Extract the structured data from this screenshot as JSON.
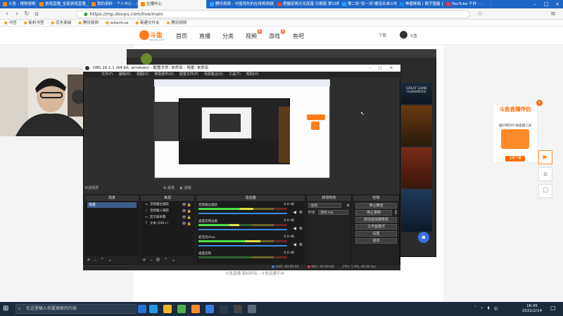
{
  "browser": {
    "tabs": [
      {
        "label": "斗鱼 - 搜狗搜索",
        "active": false
      },
      {
        "label": "游戏直播_全部游戏直播_斗鱼直播",
        "active": false
      },
      {
        "label": "我的资料 - 个人中心 - 斗鱼",
        "active": false
      },
      {
        "label": "主播中心",
        "active": true
      },
      {
        "label": "腾讯视频 - 中国领先的在线视频媒体",
        "active": false
      },
      {
        "label": "把握疫情文化底蕴 日报版 第33期",
        "active": false
      },
      {
        "label": "神盾降临 ( 数字图鉴 ) - 知乎",
        "active": false
      },
      {
        "label": "第二轮\"双一流\"建设名单公布",
        "active": false
      },
      {
        "label": "YouTube 千杯 - ..",
        "active": false
      }
    ],
    "url": "https://mp.douyu.com/live/main",
    "bookmarks": [
      "书签",
      "新机书签",
      "京东商城",
      "腾讯视频",
      "edianhua",
      "新建文件夹",
      "腾讯视频"
    ]
  },
  "douyu": {
    "logo_text": "斗鱼",
    "logo_sub": "douyu.com",
    "nav": [
      {
        "label": "首页",
        "badge": ""
      },
      {
        "label": "直播",
        "badge": ""
      },
      {
        "label": "分类",
        "badge": ""
      },
      {
        "label": "视频",
        "badge": "新"
      },
      {
        "label": "游戏",
        "badge": "热"
      },
      {
        "label": "鱼吧",
        "badge": ""
      }
    ],
    "download": "下载",
    "user": "斗鱼",
    "footer_text": "斗鱼直播 版权所有 · 斗鱼直播平台"
  },
  "obs": {
    "title": "OBS 26.1.1 (64-bit, windows) - 配置文件: 未命名 - 场景: 未命名",
    "menu": [
      "文件(F)",
      "编辑(E)",
      "视图(V)",
      "停靠部件(D)",
      "配置文件(P)",
      "场景集合(S)",
      "工具(T)",
      "帮助(H)"
    ],
    "no_source": "未选择源",
    "preview_controls": [
      "属性",
      "滤镜"
    ],
    "scenes_title": "场景",
    "scenes": [
      "场景"
    ],
    "sources_title": "来源",
    "sources": [
      {
        "icon": "audio-output-icon",
        "label": "音频输出捕获"
      },
      {
        "icon": "mic-icon",
        "label": "音频输入捕获"
      },
      {
        "icon": "window-capture-icon",
        "label": "显示器采集"
      },
      {
        "icon": "text-icon",
        "label": "文本 (GDI+)"
      }
    ],
    "mixer_title": "混音器",
    "mixer": [
      {
        "name": "音频输出捕获",
        "db": "0.0 dB",
        "level": 0.62
      },
      {
        "name": "桌面音频设备",
        "db": "0.0 dB",
        "level": 0.46
      },
      {
        "name": "麦克风/Aux",
        "db": "0.0 dB",
        "level": 0.7
      },
      {
        "name": "桌面音频",
        "db": "0.0 dB",
        "level": 0.0
      }
    ],
    "transitions_title": "转场特效",
    "transition_value": "淡出",
    "duration_label": "时长",
    "duration_value": "300 ms",
    "controls_title": "控制",
    "controls": [
      "停止推流",
      "停止录制",
      "启动虚拟摄像机",
      "工作室模式",
      "设置",
      "退出"
    ],
    "status": [
      "LIVE: 00:00:00",
      "REC: 00:00:00",
      "CPU: 1.4%, 60.00 fps"
    ]
  },
  "side": {
    "guarantee": "GREAT GAME GUARANTEE"
  },
  "ad": {
    "title": "斗鱼直播伴侣",
    "sub": "超好用的PC端直播工具",
    "button": "立即下载",
    "close": "×"
  },
  "taskbar": {
    "search_placeholder": "在这里输入你要搜索的内容",
    "time": "16:45",
    "date": "2022/2/14"
  },
  "colors": {
    "brand": "#ff7d1a",
    "tabstrip": "#1f66c6",
    "obs_bg": "#2e2e2e",
    "taskbar": "#1b2a3c"
  }
}
